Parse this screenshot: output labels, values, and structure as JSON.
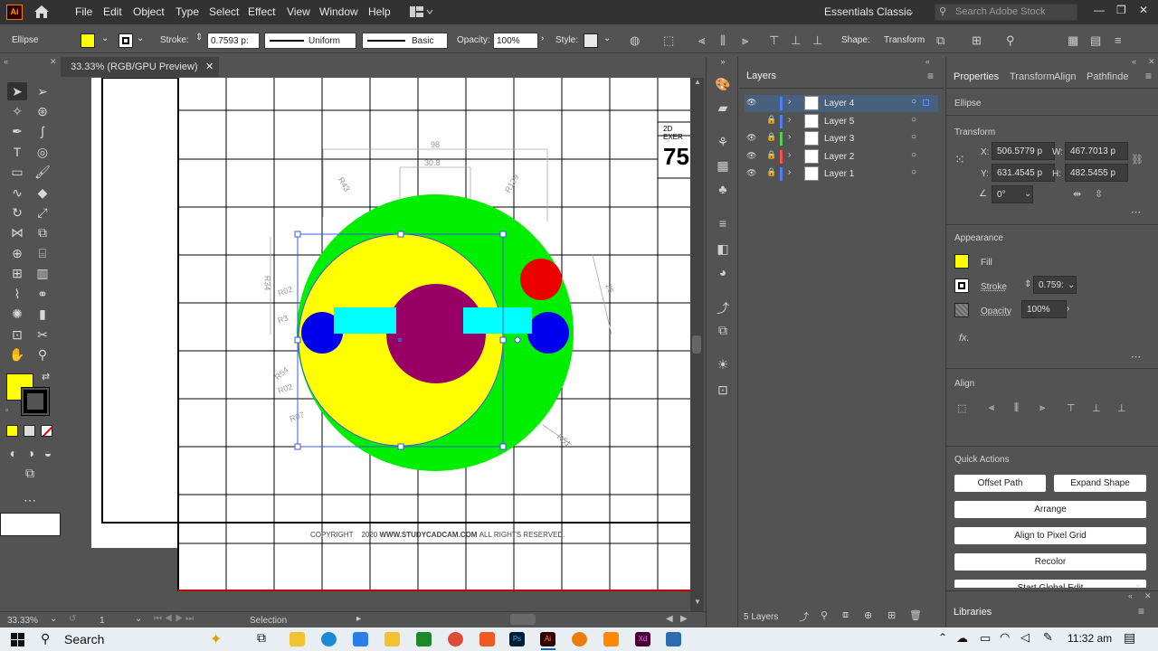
{
  "menubar": {
    "logo": "Ai",
    "items": [
      "File",
      "Edit",
      "Object",
      "Type",
      "Select",
      "Effect",
      "View",
      "Window",
      "Help"
    ],
    "workspace": "Essentials Classic",
    "search_placeholder": "Search Adobe Stock"
  },
  "controlbar": {
    "object_type": "Ellipse",
    "stroke_label": "Stroke:",
    "stroke_value": "0.7593 p:",
    "stroke_profile": "Uniform",
    "brush": "Basic",
    "opacity_label": "Opacity:",
    "opacity_value": "100%",
    "style_label": "Style:",
    "shape_label": "Shape:",
    "transform_label": "Transform",
    "fill_color": "#ffff00"
  },
  "document": {
    "tab_title": "33.33% (RGB/GPU Preview)",
    "drawing": {
      "title_block": "2D EXER",
      "number": "75",
      "copyright_prefix": "COPYRIGHT",
      "copyright_year": "2020",
      "copyright_site": "WWW.STUDYCADCAM.COM",
      "copyright_suffix": "ALL RIGHTS RESERVED.",
      "dims": [
        "98",
        "30.8",
        "R43",
        "R129",
        "R34",
        "R02",
        "R54",
        "R02",
        "R07",
        "R80",
        "R3",
        "26",
        "R51"
      ]
    }
  },
  "statusbar": {
    "zoom": "33.33%",
    "artboard": "1",
    "tool": "Selection"
  },
  "layers": {
    "tab": "Layers",
    "items": [
      {
        "name": "Layer 4",
        "color": "#4f7cff",
        "selected": true
      },
      {
        "name": "Layer 5",
        "color": "#4f7cff",
        "selected": false
      },
      {
        "name": "Layer 3",
        "color": "#50d050",
        "selected": false
      },
      {
        "name": "Layer 2",
        "color": "#ff4f4f",
        "selected": false
      },
      {
        "name": "Layer 1",
        "color": "#4f7cff",
        "selected": false
      }
    ],
    "count": "5 Layers"
  },
  "properties": {
    "tabs": [
      "Properties",
      "Transform",
      "Align",
      "Pathfinde"
    ],
    "object_type": "Ellipse",
    "transform": {
      "title": "Transform",
      "x_label": "X:",
      "x": "506.5779 p",
      "y_label": "Y:",
      "y": "631.4545 p",
      "w_label": "W:",
      "w": "467.7013 p",
      "h_label": "H:",
      "h": "482.5455 p",
      "angle": "0°"
    },
    "appearance": {
      "title": "Appearance",
      "fill_label": "Fill",
      "stroke_label": "Stroke",
      "stroke_value": "0.759:",
      "opacity_label": "Opacity",
      "opacity_value": "100%"
    },
    "align_title": "Align",
    "quick_actions": {
      "title": "Quick Actions",
      "offset_path": "Offset Path",
      "expand_shape": "Expand Shape",
      "arrange": "Arrange",
      "align_pixel": "Align to Pixel Grid",
      "recolor": "Recolor",
      "global_edit": "Start Global Edit"
    },
    "libraries": "Libraries"
  },
  "taskbar": {
    "search": "Search",
    "time": "11:32 am"
  }
}
